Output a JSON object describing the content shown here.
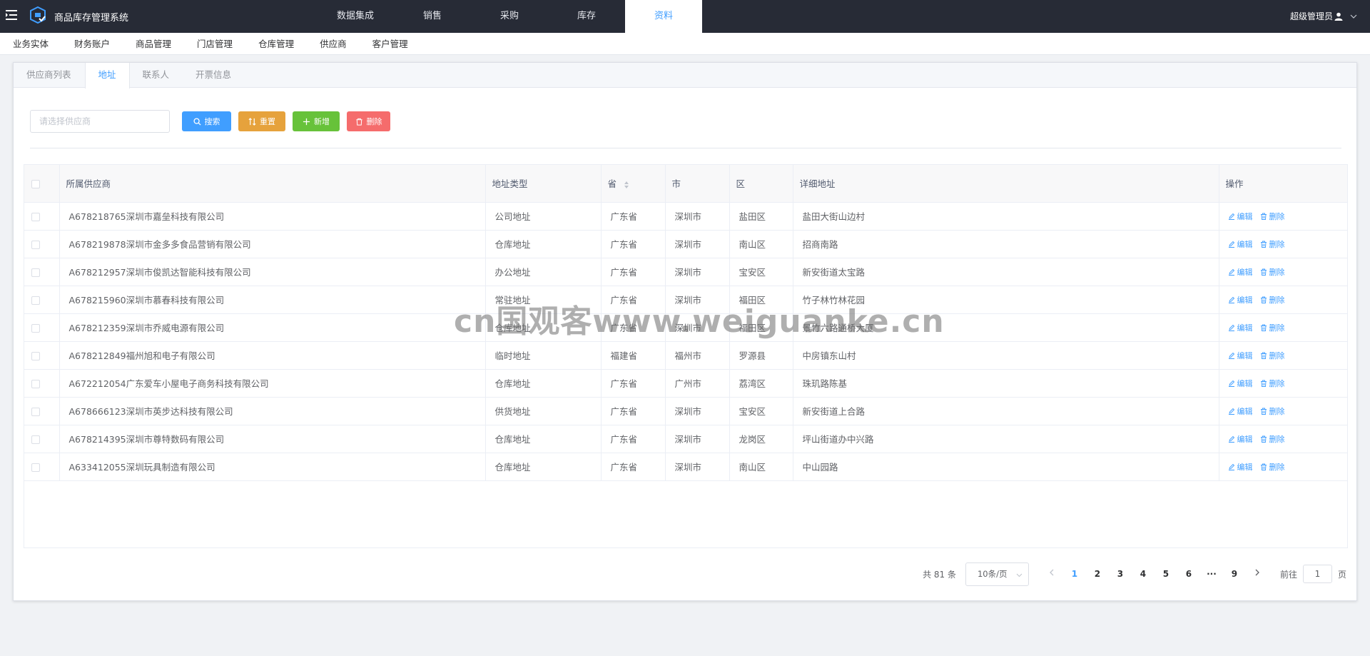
{
  "app": {
    "title": "商品库存管理系统"
  },
  "top_nav": [
    "数据集成",
    "销售",
    "采购",
    "库存",
    "资料"
  ],
  "top_nav_active": 4,
  "user": {
    "name": "超级管理员"
  },
  "sub_nav": [
    "业务实体",
    "财务账户",
    "商品管理",
    "门店管理",
    "仓库管理",
    "供应商",
    "客户管理"
  ],
  "tabs": [
    "供应商列表",
    "地址",
    "联系人",
    "开票信息"
  ],
  "tabs_active": 1,
  "search": {
    "placeholder": "请选择供应商",
    "value": ""
  },
  "buttons": {
    "search": "搜索",
    "reset": "重置",
    "add": "新增",
    "delete": "删除"
  },
  "table": {
    "headers": [
      "所属供应商",
      "地址类型",
      "省",
      "市",
      "区",
      "详细地址",
      "操作"
    ],
    "rows": [
      {
        "supplier": "A678218765深圳市嘉垒科技有限公司",
        "type": "公司地址",
        "province": "广东省",
        "city": "深圳市",
        "district": "盐田区",
        "address": "盐田大街山边村"
      },
      {
        "supplier": "A678219878深圳市金多多食品营销有限公司",
        "type": "仓库地址",
        "province": "广东省",
        "city": "深圳市",
        "district": "南山区",
        "address": "招商南路"
      },
      {
        "supplier": "A678212957深圳市俊凯达智能科技有限公司",
        "type": "办公地址",
        "province": "广东省",
        "city": "深圳市",
        "district": "宝安区",
        "address": "新安街道太宝路"
      },
      {
        "supplier": "A678215960深圳市慕春科技有限公司",
        "type": "常驻地址",
        "province": "广东省",
        "city": "深圳市",
        "district": "福田区",
        "address": "竹子林竹林花园"
      },
      {
        "supplier": "A678212359深圳市乔威电源有限公司",
        "type": "仓库地址",
        "province": "广东省",
        "city": "深圳市",
        "district": "福田区",
        "address": "景竹六路通桥大厦"
      },
      {
        "supplier": "A678212849福州旭和电子有限公司",
        "type": "临时地址",
        "province": "福建省",
        "city": "福州市",
        "district": "罗源县",
        "address": "中房镇东山村"
      },
      {
        "supplier": "A672212054广东爱车小屋电子商务科技有限公司",
        "type": "仓库地址",
        "province": "广东省",
        "city": "广州市",
        "district": "荔湾区",
        "address": "珠玑路陈基"
      },
      {
        "supplier": "A678666123深圳市英步达科技有限公司",
        "type": "供货地址",
        "province": "广东省",
        "city": "深圳市",
        "district": "宝安区",
        "address": "新安街道上合路"
      },
      {
        "supplier": "A678214395深圳市尊特数码有限公司",
        "type": "仓库地址",
        "province": "广东省",
        "city": "深圳市",
        "district": "龙岗区",
        "address": "坪山街道办中兴路"
      },
      {
        "supplier": "A633412055深圳玩具制造有限公司",
        "type": "仓库地址",
        "province": "广东省",
        "city": "深圳市",
        "district": "南山区",
        "address": "中山园路"
      }
    ],
    "row_actions": {
      "edit": "编辑",
      "delete": "删除"
    }
  },
  "pagination": {
    "total_text": "共 81 条",
    "page_size": "10条/页",
    "pages": [
      "1",
      "2",
      "3",
      "4",
      "5",
      "6",
      "···",
      "9"
    ],
    "current": "1",
    "goto_prefix": "前往",
    "goto_value": "1",
    "goto_suffix": "页"
  },
  "watermark": "cn国观客www.weiguanke.cn",
  "colors": {
    "topbar": "#272b36",
    "primary": "#409eff",
    "warning": "#e6a23c",
    "success": "#67c23a",
    "danger": "#f56c6c"
  }
}
